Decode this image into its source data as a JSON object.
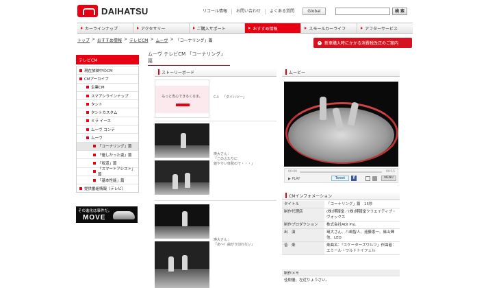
{
  "header": {
    "logo_text": "DAIHATSU",
    "utility_links": [
      "リコール情報",
      "お問い合わせ",
      "よくある質問"
    ],
    "global_label": "Global",
    "search_placeholder": "",
    "search_button": "検 索"
  },
  "nav": {
    "items": [
      {
        "label": "カーラインナップ",
        "active": false
      },
      {
        "label": "アクセサリー",
        "active": false
      },
      {
        "label": "ご購入サポート",
        "active": false
      },
      {
        "label": "おすすめ情報",
        "active": true
      },
      {
        "label": "スモールカーライフ",
        "active": false
      },
      {
        "label": "アフターサービス",
        "active": false
      }
    ]
  },
  "breadcrumb": {
    "items": [
      "トップ",
      "おすすめ情報",
      "テレビCM",
      "ムーヴ"
    ],
    "current": "「コーナリング」篇",
    "separator": ">"
  },
  "notice_button": "新車購入時にかかる消費税改正のご案内",
  "page_title": "ムーヴ テレビCM 「コーナリング」篇",
  "sidebar": {
    "heading": "テレビCM",
    "items": [
      {
        "label": "現在放映中のCM",
        "level": 1,
        "selected": false
      },
      {
        "label": "CMアーカイブ",
        "level": 1,
        "selected": false
      },
      {
        "label": "企業CM",
        "level": 2,
        "selected": false
      },
      {
        "label": "スマアシラインナップ",
        "level": 2,
        "selected": false
      },
      {
        "label": "タント",
        "level": 2,
        "selected": false
      },
      {
        "label": "タントカスタム",
        "level": 2,
        "selected": false
      },
      {
        "label": "ミラ イース",
        "level": 2,
        "selected": false
      },
      {
        "label": "ムーヴ コンテ",
        "level": 2,
        "selected": false
      },
      {
        "label": "ムーヴ",
        "level": 2,
        "selected": false
      },
      {
        "label": "「コーナリング」篇",
        "level": 3,
        "selected": true
      },
      {
        "label": "「優しかった姿」篇",
        "level": 3,
        "selected": false
      },
      {
        "label": "「坂道」篇",
        "level": 3,
        "selected": false
      },
      {
        "label": "「スマートアシスト」篇",
        "level": 3,
        "selected": false
      },
      {
        "label": "「基本性能」篇",
        "level": 3,
        "selected": false
      },
      {
        "label": "提供番組情報（テレビ）",
        "level": 1,
        "selected": false
      }
    ],
    "banner": {
      "line1": "その進化は事件だ。",
      "line2": "MOVE"
    }
  },
  "storyboard": {
    "heading": "ストーリーボード",
    "frame1_caption": "もっと安心できるくるま。",
    "captions": [
      {
        "text": "C.I：\n「ダイハツー」"
      },
      {
        "text": "瑛大さん：\n「このふたりに\n値やすい体勢ので・・・」"
      },
      {
        "text": "瑛大さん：\n「あ～！曲がり切れない」"
      }
    ]
  },
  "movie": {
    "heading": "ムービー",
    "time_start": "00:00",
    "time_end": "00:15",
    "play_label": "PLAY",
    "tweet_label": "Tweet",
    "fb_label": "f",
    "menu_label": "MENU"
  },
  "cm_info": {
    "heading": "CMインフォメーション",
    "rows": [
      {
        "key": "タイトル",
        "value": "「コーナリング」篇　15秒"
      },
      {
        "key": "制作代理店",
        "value": "(株)博報堂／(株)博報堂クリエイティブ・ヴォックス"
      },
      {
        "key": "制作プロダクション",
        "value": "株式会社AOI Pro."
      },
      {
        "key": "出　演",
        "value": "瑛大さん、八嶋智人、遠藤憲一、篠山輝信、LEO"
      },
      {
        "key": "音　楽",
        "value": "楽曲名：「スケーターズワルツ」作曲者：エミール・ワルトトイフェル"
      }
    ],
    "memo_heading": "制作メモ",
    "memo_text": "佳樹優、左近りょうさい。"
  }
}
